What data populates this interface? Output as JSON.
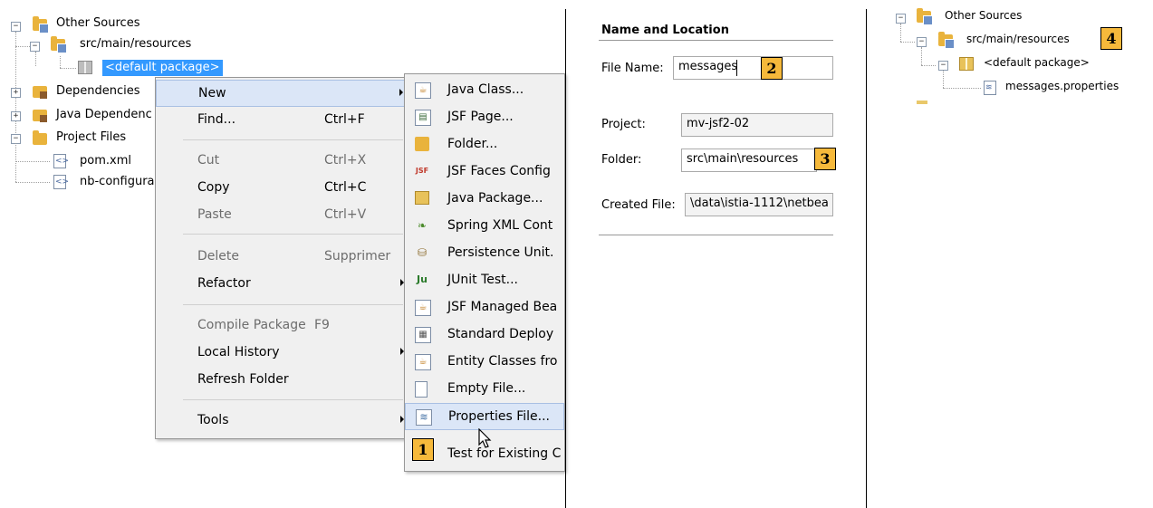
{
  "panel1": {
    "tree": {
      "other_sources": "Other Sources",
      "src_main_resources": "src/main/resources",
      "default_package": "<default package>",
      "dependencies": "Dependencies",
      "java_dependencies": "Java Dependenc",
      "project_files": "Project Files",
      "pom": "pom.xml",
      "nb_config": "nb-configura"
    },
    "context_menu": {
      "items": [
        {
          "label": "New",
          "shortcut": ""
        },
        {
          "label": "Find...",
          "shortcut": "Ctrl+F"
        },
        {
          "label": "Cut",
          "shortcut": "Ctrl+X"
        },
        {
          "label": "Copy",
          "shortcut": "Ctrl+C"
        },
        {
          "label": "Paste",
          "shortcut": "Ctrl+V"
        },
        {
          "label": "Delete",
          "shortcut": "Supprimer"
        },
        {
          "label": "Refactor",
          "shortcut": ""
        },
        {
          "label": "Compile Package",
          "shortcut": "F9"
        },
        {
          "label": "Local History",
          "shortcut": ""
        },
        {
          "label": "Refresh Folder",
          "shortcut": ""
        },
        {
          "label": "Tools",
          "shortcut": ""
        }
      ]
    },
    "submenu": {
      "items": [
        {
          "label": "Java Class...",
          "icon": "java-class-icon"
        },
        {
          "label": "JSF Page...",
          "icon": "jsf-page-icon"
        },
        {
          "label": "Folder...",
          "icon": "folder-icon"
        },
        {
          "label": "JSF Faces Config",
          "icon": "jsf-faces-config-icon"
        },
        {
          "label": "Java Package...",
          "icon": "java-package-icon"
        },
        {
          "label": "Spring XML Cont",
          "icon": "spring-xml-icon"
        },
        {
          "label": "Persistence Unit.",
          "icon": "persistence-unit-icon"
        },
        {
          "label": "JUnit Test...",
          "icon": "junit-icon"
        },
        {
          "label": "JSF Managed Bea",
          "icon": "jsf-managed-bean-icon"
        },
        {
          "label": "Standard Deploy",
          "icon": "standard-deploy-icon"
        },
        {
          "label": "Entity Classes fro",
          "icon": "entity-classes-icon"
        },
        {
          "label": "Empty File...",
          "icon": "empty-file-icon"
        },
        {
          "label": "Properties File...",
          "icon": "properties-file-icon"
        },
        {
          "label": "Test for Existing C",
          "icon": ""
        }
      ]
    },
    "badge": "1"
  },
  "panel2": {
    "header": "Name and Location",
    "file_name_label": "File Name:",
    "file_name_value": "messages",
    "project_label": "Project:",
    "project_value": "mv-jsf2-02",
    "folder_label": "Folder:",
    "folder_value": "src\\main\\resources",
    "created_label": "Created File:",
    "created_value": "\\data\\istia-1112\\netbea",
    "badge_2": "2",
    "badge_3": "3"
  },
  "panel3": {
    "other_sources": "Other Sources",
    "src_main_resources": "src/main/resources",
    "default_package": "<default package>",
    "messages_properties": "messages.properties",
    "badge": "4"
  },
  "colors": {
    "selection": "#3399ff",
    "badge": "#f6b93b",
    "menu_bg": "#f0f0f0",
    "highlight": "#dbe6f7"
  }
}
